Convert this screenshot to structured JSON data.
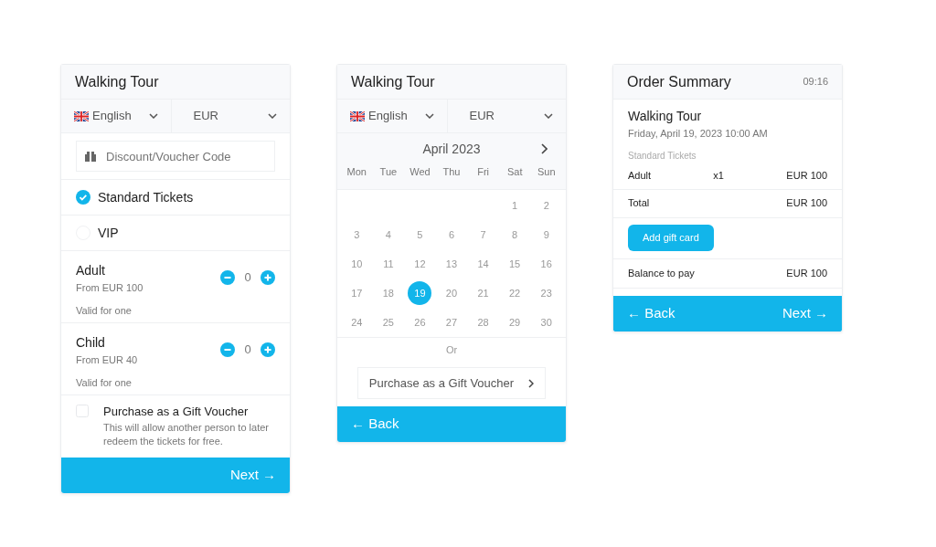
{
  "booking": {
    "title": "Walking Tour",
    "language": "English",
    "currency": "EUR",
    "voucher_placeholder": "Discount/Voucher Code",
    "ticket_types": [
      {
        "label": "Standard Tickets",
        "selected": true
      },
      {
        "label": "VIP",
        "selected": false
      }
    ],
    "tickets": [
      {
        "name": "Adult",
        "price": "From EUR 100",
        "note": "Valid for one",
        "count": "0"
      },
      {
        "name": "Child",
        "price": "From EUR 40",
        "note": "Valid for one",
        "count": "0"
      }
    ],
    "gift_option": {
      "label": "Purchase as a Gift Voucher",
      "description": "This will allow another person to later redeem the tickets for free.",
      "checked": false
    },
    "next_button": "Next →"
  },
  "date_picker": {
    "title": "Walking Tour",
    "language": "English",
    "currency": "EUR",
    "month": "April 2023",
    "weekdays": [
      "Mon",
      "Tue",
      "Wed",
      "Thu",
      "Fri",
      "Sat",
      "Sun"
    ],
    "weeks": [
      {
        "kind": "leading",
        "days": [
          {
            "day": "1",
            "selected": false
          },
          {
            "day": "2",
            "selected": false
          }
        ]
      },
      {
        "days": [
          {
            "day": "3",
            "selected": false
          },
          {
            "day": "4",
            "selected": false
          },
          {
            "day": "5",
            "selected": false
          },
          {
            "day": "6",
            "selected": false
          },
          {
            "day": "7",
            "selected": false
          },
          {
            "day": "8",
            "selected": false
          },
          {
            "day": "9",
            "selected": false
          }
        ]
      },
      {
        "days": [
          {
            "day": "10",
            "selected": false
          },
          {
            "day": "11",
            "selected": false
          },
          {
            "day": "12",
            "selected": false
          },
          {
            "day": "13",
            "selected": false
          },
          {
            "day": "14",
            "selected": false
          },
          {
            "day": "15",
            "selected": false
          },
          {
            "day": "16",
            "selected": false
          }
        ]
      },
      {
        "days": [
          {
            "day": "17",
            "selected": false
          },
          {
            "day": "18",
            "selected": false
          },
          {
            "day": "19",
            "selected": true
          },
          {
            "day": "20",
            "selected": false
          },
          {
            "day": "21",
            "selected": false
          },
          {
            "day": "22",
            "selected": false
          },
          {
            "day": "23",
            "selected": false
          }
        ]
      },
      {
        "days": [
          {
            "day": "24",
            "selected": false
          },
          {
            "day": "25",
            "selected": false
          },
          {
            "day": "26",
            "selected": false
          },
          {
            "day": "27",
            "selected": false
          },
          {
            "day": "28",
            "selected": false
          },
          {
            "day": "29",
            "selected": false
          },
          {
            "day": "30",
            "selected": false
          }
        ]
      }
    ],
    "or_text": "Or",
    "gift_button": "Purchase as a Gift Voucher",
    "back_button": "← Back"
  },
  "order_summary": {
    "title": "Order Summary",
    "time": "09:16",
    "tour": "Walking Tour",
    "date": "Friday, April 19, 2023 10:00 AM",
    "section": "Standard Tickets",
    "lines": [
      {
        "label": "Adult",
        "quantity": "x1",
        "amount": "EUR 100"
      }
    ],
    "total": {
      "label": "Total",
      "amount": "EUR 100"
    },
    "gift_button": "Add gift card",
    "balance": {
      "label": "Balance to pay",
      "amount": "EUR 100"
    },
    "back_button": "← Back",
    "next_button": "Next →"
  }
}
